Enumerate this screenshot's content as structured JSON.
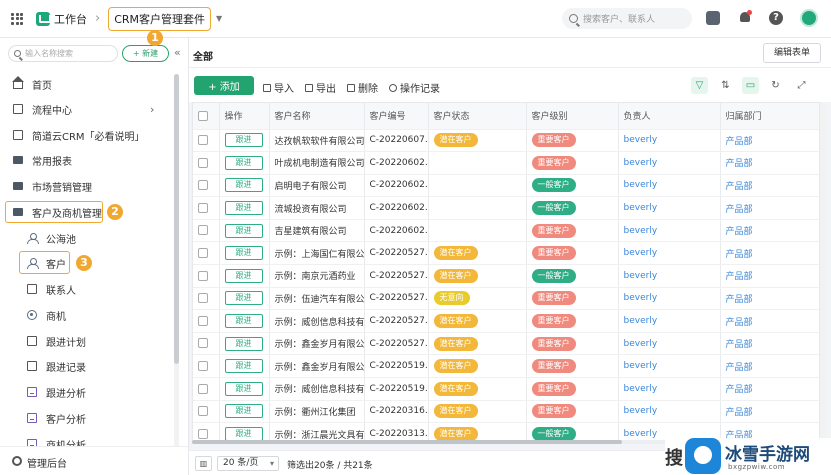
{
  "topbar": {
    "workspace": "工作台",
    "breadcrumb": "CRM客户管理套件",
    "search_placeholder": "搜索客户、联系人"
  },
  "sidebar": {
    "search_placeholder": "输入名称搜索",
    "new_label": "+ 新建",
    "items": [
      {
        "label": "首页",
        "icon": "home-icon"
      },
      {
        "label": "流程中心",
        "icon": "doc-icon"
      },
      {
        "label": "简道云CRM「必看说明」",
        "icon": "doc-icon"
      },
      {
        "label": "常用报表",
        "icon": "folder-icon"
      },
      {
        "label": "市场营销管理",
        "icon": "folder-icon"
      },
      {
        "label": "客户及商机管理",
        "icon": "folder-open-icon"
      },
      {
        "label": "公海池",
        "icon": "user-icon"
      },
      {
        "label": "客户",
        "icon": "user-icon"
      },
      {
        "label": "联系人",
        "icon": "doc-icon"
      },
      {
        "label": "商机",
        "icon": "target-icon"
      },
      {
        "label": "跟进计划",
        "icon": "doc-icon"
      },
      {
        "label": "跟进记录",
        "icon": "doc-icon"
      },
      {
        "label": "跟进分析",
        "icon": "chart-icon"
      },
      {
        "label": "客户分析",
        "icon": "chart-icon"
      },
      {
        "label": "商机分析",
        "icon": "chart-icon"
      }
    ],
    "footer": "管理后台"
  },
  "annotations": {
    "n1": "1",
    "n2": "2",
    "n3": "3"
  },
  "main": {
    "title": "全部",
    "edit_form": "编辑表单"
  },
  "toolbar": {
    "add": "+ 添加",
    "import": "导入",
    "export": "导出",
    "delete": "删除",
    "log": "操作记录"
  },
  "table": {
    "headers": [
      "操作",
      "客户名称",
      "客户编号",
      "客户状态",
      "客户级别",
      "负责人",
      "归属部门"
    ],
    "action_label": "跟进",
    "rows": [
      {
        "name": "达孜帆软软件有限公司",
        "code": "C-20220607...",
        "status": "潜在客户",
        "level": "重要客户",
        "owner": "beverly",
        "dept": "产品部"
      },
      {
        "name": "叶成机电制造有限公司",
        "code": "C-20220602...",
        "status": "",
        "level": "重要客户",
        "owner": "beverly",
        "dept": "产品部"
      },
      {
        "name": "启明电子有限公司",
        "code": "C-20220602...",
        "status": "",
        "level": "一般客户",
        "owner": "beverly",
        "dept": "产品部"
      },
      {
        "name": "流城投资有限公司",
        "code": "C-20220602...",
        "status": "",
        "level": "一般客户",
        "owner": "beverly",
        "dept": "产品部"
      },
      {
        "name": "吉星建筑有限公司",
        "code": "C-20220602...",
        "status": "",
        "level": "重要客户",
        "owner": "beverly",
        "dept": "产品部"
      },
      {
        "name": "示例：上海国仁有限公司",
        "code": "C-20220527...",
        "status": "潜在客户",
        "level": "重要客户",
        "owner": "beverly",
        "dept": "产品部"
      },
      {
        "name": "示例：南京元酒药业",
        "code": "C-20220527...",
        "status": "潜在客户",
        "level": "一般客户",
        "owner": "beverly",
        "dept": "产品部"
      },
      {
        "name": "示例：伍迪汽车有限公司",
        "code": "C-20220527...",
        "status": "无意向",
        "level": "重要客户",
        "owner": "beverly",
        "dept": "产品部"
      },
      {
        "name": "示例：威创信息科技有限公司",
        "code": "C-20220527...",
        "status": "潜在客户",
        "level": "重要客户",
        "owner": "beverly",
        "dept": "产品部"
      },
      {
        "name": "示例：鑫金岁月有限公司",
        "code": "C-20220527...",
        "status": "潜在客户",
        "level": "重要客户",
        "owner": "beverly",
        "dept": "产品部"
      },
      {
        "name": "示例：鑫金岁月有限公司",
        "code": "C-20220519...",
        "status": "潜在客户",
        "level": "重要客户",
        "owner": "beverly",
        "dept": "产品部"
      },
      {
        "name": "示例：威创信息科技有限公司",
        "code": "C-20220519...",
        "status": "潜在客户",
        "level": "重要客户",
        "owner": "beverly",
        "dept": "产品部"
      },
      {
        "name": "示例：衢州江化集团",
        "code": "C-20220316...",
        "status": "潜在客户",
        "level": "重要客户",
        "owner": "beverly",
        "dept": "产品部"
      },
      {
        "name": "示例：浙江晨光文具有限公司",
        "code": "C-20220313...",
        "status": "潜在客户",
        "level": "一般客户",
        "owner": "beverly",
        "dept": "产品部"
      }
    ]
  },
  "pager": {
    "page_size": "20 条/页",
    "summary": "筛选出20条 / 共21条"
  },
  "watermark": {
    "sou": "搜",
    "name": "冰雪手游网",
    "url": "bxgzpwiw.com"
  },
  "colors": {
    "accent": "#23a36f",
    "highlight": "#f0a830",
    "potential": "#f3b73a",
    "important": "#f08a7e",
    "normal": "#2fae86",
    "nointent": "#e9cc2c"
  }
}
